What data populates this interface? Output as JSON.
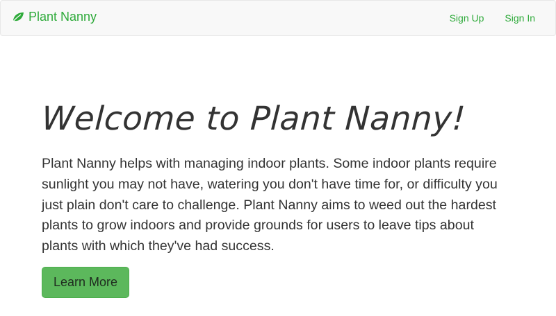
{
  "brand": {
    "name": "Plant Nanny",
    "icon": "leaf-icon",
    "color": "#2eaa3a"
  },
  "nav": {
    "sign_up": "Sign Up",
    "sign_in": "Sign In"
  },
  "hero": {
    "title": "Welcome to Plant Nanny!",
    "text": "Plant Nanny helps with managing indoor plants. Some indoor plants require sunlight you may not have, watering you don't have time for, or difficulty you just plain don't care to challenge. Plant Nanny aims to weed out the hardest plants to grow indoors and provide grounds for users to leave tips about plants with which they've had success.",
    "button_label": "Learn More",
    "button_color": "#5cb85c"
  }
}
